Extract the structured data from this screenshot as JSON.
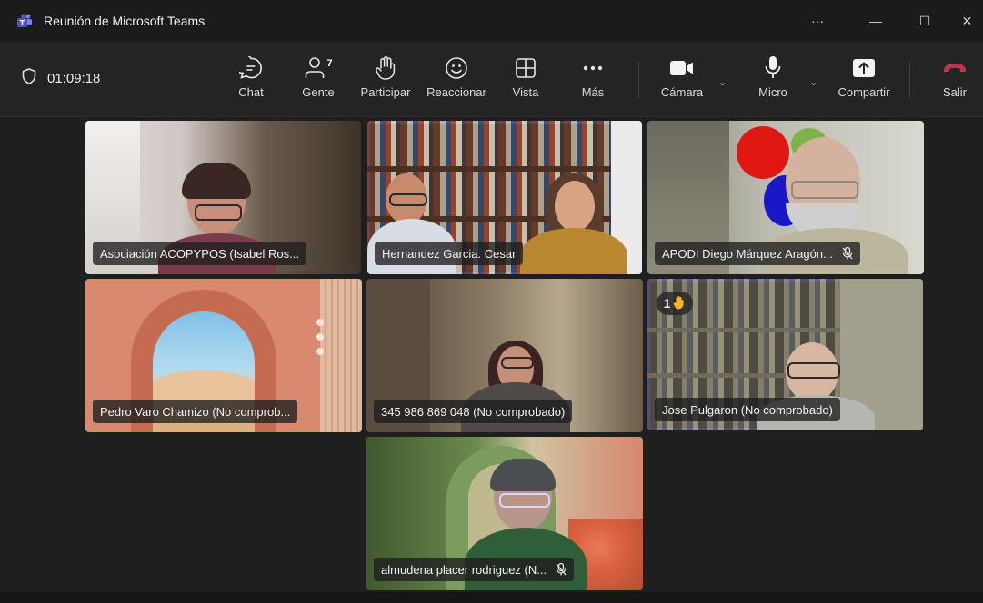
{
  "window": {
    "title": "Reunión de Microsoft Teams",
    "controls": [
      "···",
      "—",
      "☐",
      "✕"
    ]
  },
  "toolbar": {
    "timer": "01:09:18",
    "chat": "Chat",
    "people": "Gente",
    "people_count": "7",
    "raise_hand": "Participar",
    "react": "Reaccionar",
    "view": "Vista",
    "more": "Más",
    "camera": "Cámara",
    "mic": "Micro",
    "share": "Compartir",
    "leave": "Salir"
  },
  "participants": [
    {
      "name": "Asociación ACOPYPOS (Isabel Ros...",
      "active": false,
      "muted": false
    },
    {
      "name": "Hernandez Garcia. Cesar",
      "active": true,
      "muted": false
    },
    {
      "name": "APODI Diego Márquez Aragón...",
      "active": false,
      "muted": true
    },
    {
      "name": "Pedro Varo Chamizo (No comprob...",
      "active": false,
      "muted": false
    },
    {
      "name": "345 986 869 048 (No comprobado)",
      "active": false,
      "muted": false
    },
    {
      "name": "Jose Pulgaron (No comprobado)",
      "active": true,
      "muted": false,
      "raised_hand_order": "1"
    },
    {
      "name": "almudena placer rodriguez (N...",
      "active": false,
      "muted": true
    }
  ],
  "colors": {
    "accent": "#7f85f5",
    "leave": "#c4314b"
  }
}
